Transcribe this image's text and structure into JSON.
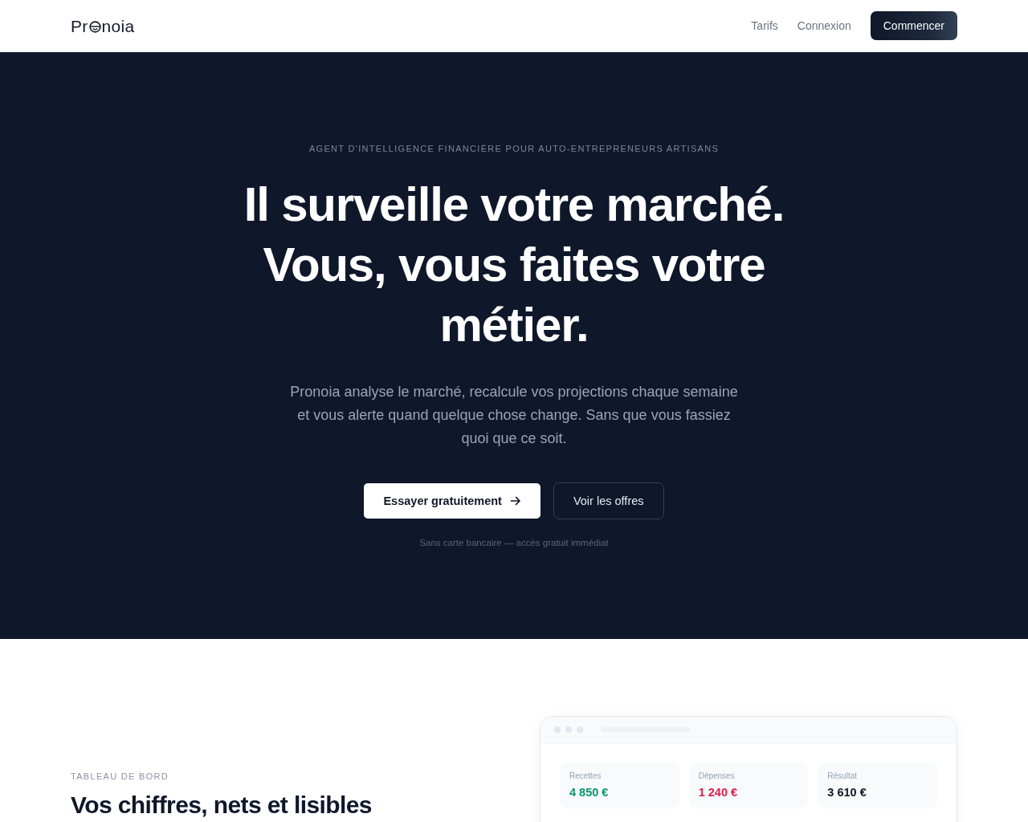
{
  "nav": {
    "logo": {
      "text_start": "Pr",
      "text_end": "noia"
    },
    "links": [
      "Tarifs",
      "Connexion"
    ],
    "cta": "Commencer"
  },
  "hero": {
    "eyebrow": "AGENT D'INTELLIGENCE FINANCIÈRE POUR AUTO-ENTREPRENEURS ARTISANS",
    "title_lines": [
      "Il surveille votre marché.",
      "Vous, vous faites votre métier."
    ],
    "lead": "Pronoia analyse le marché, recalcule vos projections chaque semaine et vous alerte quand quelque chose change. Sans que vous fassiez quoi que ce soit.",
    "primary_button": "Essayer gratuitement",
    "secondary_button": "Voir les offres",
    "note": "Sans carte bancaire — accès gratuit immédiat"
  },
  "dashboard": {
    "eyebrow": "TABLEAU DE BORD",
    "title": "Vos chiffres, nets et lisibles",
    "stats": [
      {
        "label": "Recettes",
        "value": "4 850 €",
        "color": "#059669"
      },
      {
        "label": "Dépenses",
        "value": "1 240 €",
        "color": "#e11d48"
      },
      {
        "label": "Résultat",
        "value": "3 610 €",
        "color": "#0f172a"
      }
    ]
  }
}
